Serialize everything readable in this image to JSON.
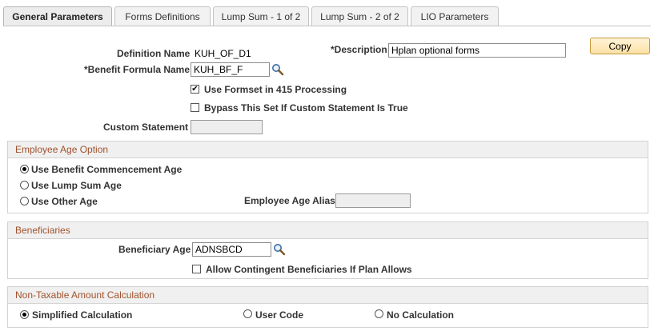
{
  "tabs": [
    {
      "label": "General Parameters",
      "active": true
    },
    {
      "label": "Forms Definitions",
      "active": false
    },
    {
      "label": "Lump Sum - 1 of 2",
      "active": false
    },
    {
      "label": "Lump Sum - 2 of 2",
      "active": false
    },
    {
      "label": "LIO Parameters",
      "active": false
    }
  ],
  "form": {
    "definition_name_label": "Definition Name",
    "definition_name_value": "KUH_OF_D1",
    "description_label": "*Description",
    "description_value": "Hplan optional forms",
    "copy_label": "Copy",
    "benefit_formula_label": "*Benefit Formula Name",
    "benefit_formula_value": "KUH_BF_F",
    "use_formset_label": "Use Formset in 415 Processing",
    "use_formset_checked": true,
    "bypass_label": "Bypass This Set If Custom Statement Is True",
    "bypass_checked": false,
    "custom_statement_label": "Custom Statement",
    "custom_statement_value": ""
  },
  "employee_age": {
    "title": "Employee Age Option",
    "options": [
      {
        "label": "Use Benefit Commencement Age",
        "selected": true
      },
      {
        "label": "Use Lump Sum Age",
        "selected": false
      },
      {
        "label": "Use Other Age",
        "selected": false
      }
    ],
    "alias_label": "Employee Age Alias",
    "alias_value": ""
  },
  "beneficiaries": {
    "title": "Beneficiaries",
    "age_label": "Beneficiary Age",
    "age_value": "ADNSBCD",
    "contingent_label": "Allow Contingent Beneficiaries If Plan Allows",
    "contingent_checked": false
  },
  "non_taxable": {
    "title": "Non-Taxable Amount Calculation",
    "options": [
      {
        "label": "Simplified Calculation",
        "selected": true
      },
      {
        "label": "User Code",
        "selected": false
      },
      {
        "label": "No Calculation",
        "selected": false
      }
    ]
  },
  "icons": {
    "lookup": "magnifier-icon",
    "check": "checkmark-icon"
  }
}
